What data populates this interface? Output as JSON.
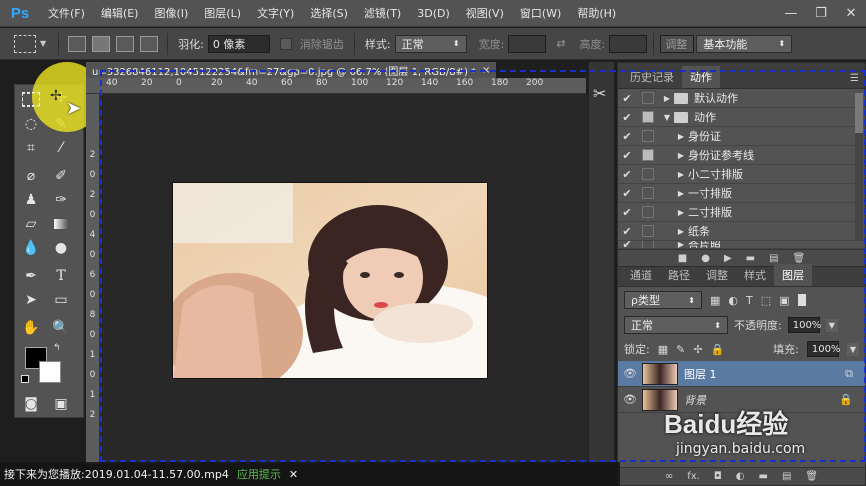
{
  "menubar": {
    "logo": "Ps",
    "items": [
      "文件(F)",
      "编辑(E)",
      "图像(I)",
      "图层(L)",
      "文字(Y)",
      "选择(S)",
      "滤镜(T)",
      "3D(D)",
      "视图(V)",
      "窗口(W)",
      "帮助(H)"
    ],
    "minimize": "—",
    "restore": "❐",
    "close": "✕"
  },
  "options": {
    "feather_label": "羽化:",
    "feather_value": "0 像素",
    "antialias_label": "消除锯齿",
    "style_label": "样式:",
    "style_value": "正常",
    "width_label": "宽度:",
    "height_label": "高度:",
    "refine_label": "调整",
    "workspace_value": "基本功能"
  },
  "document": {
    "tab_title": "u=3326846112,1045122254&fm=27&gp=0.jpg @ 66.7% (图层 1, RGB/8#) *",
    "tab_close": "×",
    "ruler_h": [
      "40",
      "20",
      "0",
      "20",
      "40",
      "60",
      "80",
      "100",
      "120",
      "140",
      "160",
      "180",
      "200"
    ],
    "ruler_v": [
      "2",
      "0",
      "2",
      "0",
      "4",
      "0",
      "6",
      "0",
      "8",
      "0",
      "1",
      "0",
      "1",
      "2"
    ]
  },
  "actions_panel": {
    "tabs": [
      "历史记录",
      "动作"
    ],
    "active_tab": "动作",
    "rows": [
      {
        "label": "默认动作",
        "type": "set",
        "expanded": false,
        "dialog": false
      },
      {
        "label": "动作",
        "type": "set",
        "expanded": true,
        "dialog": true
      },
      {
        "label": "身份证",
        "type": "action",
        "dialog": false
      },
      {
        "label": "身份证参考线",
        "type": "action",
        "dialog": true
      },
      {
        "label": "小二寸排版",
        "type": "action",
        "dialog": false
      },
      {
        "label": "一寸排版",
        "type": "action",
        "dialog": false
      },
      {
        "label": "二寸排版",
        "type": "action",
        "dialog": false
      },
      {
        "label": "纸条",
        "type": "action",
        "dialog": false
      },
      {
        "label": "合片照",
        "type": "action",
        "dialog": false
      }
    ],
    "footer_icons": [
      "■",
      "●",
      "▶",
      "▬",
      "▤",
      "🗑"
    ]
  },
  "layers_panel": {
    "tabs": [
      "通道",
      "路径",
      "调整",
      "样式",
      "图层"
    ],
    "active_tab": "图层",
    "filter_value": "ρ类型",
    "blend_mode": "正常",
    "opacity_label": "不透明度:",
    "opacity_value": "100%",
    "lock_label": "锁定:",
    "fill_label": "填充:",
    "fill_value": "100%",
    "layers": [
      {
        "name": "图层 1",
        "selected": true
      },
      {
        "name": "背景",
        "selected": false
      }
    ],
    "footer": "fx."
  },
  "watermark": {
    "text": "Baidu经验",
    "url": "jingyan.baidu.com"
  },
  "bottom_bar": {
    "text": "接下来为您播放:2019.01.04-11.57.00.mp4",
    "hint": "应用提示",
    "close": "✕"
  },
  "colors": {
    "accent_blue": "#31a8ff",
    "selection_row": "#5a7aa2",
    "marquee": "#1a2fc7",
    "cursor_highlight": "#e8e020"
  }
}
